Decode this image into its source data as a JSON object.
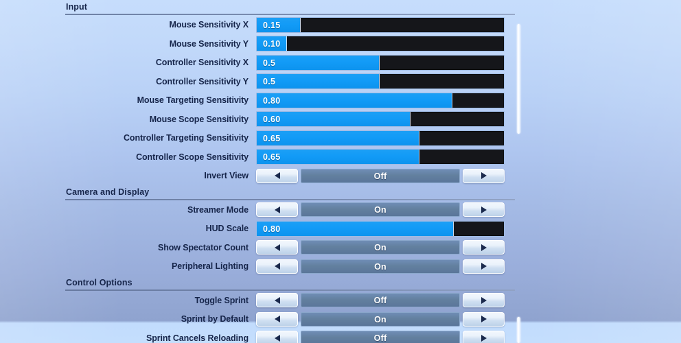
{
  "theme": {
    "slider_fill": "#129bf7",
    "slider_track": "#15161a",
    "selector_bg": "#63809f",
    "label_color": "#16254a"
  },
  "sections": [
    {
      "title": "Input",
      "rows": [
        {
          "type": "slider",
          "label": "Mouse Sensitivity X",
          "value": "0.15",
          "percent": 17.5
        },
        {
          "type": "slider",
          "label": "Mouse Sensitivity Y",
          "value": "0.10",
          "percent": 12.0
        },
        {
          "type": "slider",
          "label": "Controller Sensitivity X",
          "value": "0.5",
          "percent": 49.5
        },
        {
          "type": "slider",
          "label": "Controller Sensitivity Y",
          "value": "0.5",
          "percent": 49.5
        },
        {
          "type": "slider",
          "label": "Mouse Targeting Sensitivity",
          "value": "0.80",
          "percent": 79.0
        },
        {
          "type": "slider",
          "label": "Mouse Scope Sensitivity",
          "value": "0.60",
          "percent": 62.0
        },
        {
          "type": "slider",
          "label": "Controller Targeting Sensitivity",
          "value": "0.65",
          "percent": 65.5
        },
        {
          "type": "slider",
          "label": "Controller Scope Sensitivity",
          "value": "0.65",
          "percent": 65.5
        },
        {
          "type": "selector",
          "label": "Invert View",
          "value": "Off"
        }
      ]
    },
    {
      "title": "Camera and Display",
      "rows": [
        {
          "type": "selector",
          "label": "Streamer Mode",
          "value": "On"
        },
        {
          "type": "slider",
          "label": "HUD Scale",
          "value": "0.80",
          "percent": 79.5
        },
        {
          "type": "selector",
          "label": "Show Spectator Count",
          "value": "On"
        },
        {
          "type": "selector",
          "label": "Peripheral Lighting",
          "value": "On"
        }
      ]
    },
    {
      "title": "Control Options",
      "rows": [
        {
          "type": "selector",
          "label": "Toggle Sprint",
          "value": "Off"
        },
        {
          "type": "selector",
          "label": "Sprint by Default",
          "value": "On"
        },
        {
          "type": "selector",
          "label": "Sprint Cancels Reloading",
          "value": "Off"
        }
      ]
    }
  ],
  "arrows": {
    "left": "left-arrow-icon",
    "right": "right-arrow-icon"
  }
}
